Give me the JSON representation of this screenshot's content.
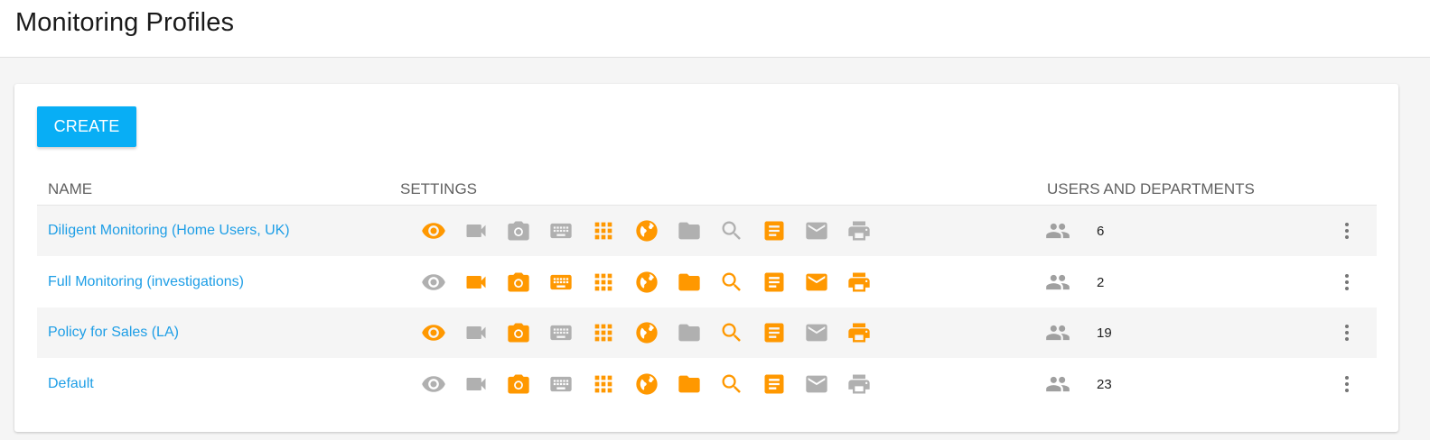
{
  "header": {
    "title": "Monitoring Profiles"
  },
  "toolbar": {
    "create_label": "CREATE"
  },
  "table": {
    "columns": [
      "NAME",
      "SETTINGS",
      "USERS AND DEPARTMENTS"
    ],
    "colors": {
      "active": "#ff9800",
      "inactive": "#b0b0b0",
      "link": "#1e9ee6"
    },
    "setting_icons": [
      "eye-icon",
      "video-camera-icon",
      "photo-camera-icon",
      "keyboard-icon",
      "apps-grid-icon",
      "globe-icon",
      "folder-icon",
      "search-icon",
      "document-icon",
      "mail-icon",
      "printer-icon"
    ],
    "rows": [
      {
        "name": "Diligent Monitoring (Home Users, UK)",
        "users_count": "6",
        "settings": [
          true,
          false,
          false,
          false,
          true,
          true,
          false,
          false,
          true,
          false,
          false
        ]
      },
      {
        "name": "Full Monitoring (investigations)",
        "users_count": "2",
        "settings": [
          false,
          true,
          true,
          true,
          true,
          true,
          true,
          true,
          true,
          true,
          true
        ]
      },
      {
        "name": "Policy for Sales (LA)",
        "users_count": "19",
        "settings": [
          true,
          false,
          true,
          false,
          true,
          true,
          false,
          true,
          true,
          false,
          true
        ]
      },
      {
        "name": "Default",
        "users_count": "23",
        "settings": [
          false,
          false,
          true,
          false,
          true,
          true,
          true,
          true,
          true,
          false,
          false
        ]
      }
    ]
  }
}
